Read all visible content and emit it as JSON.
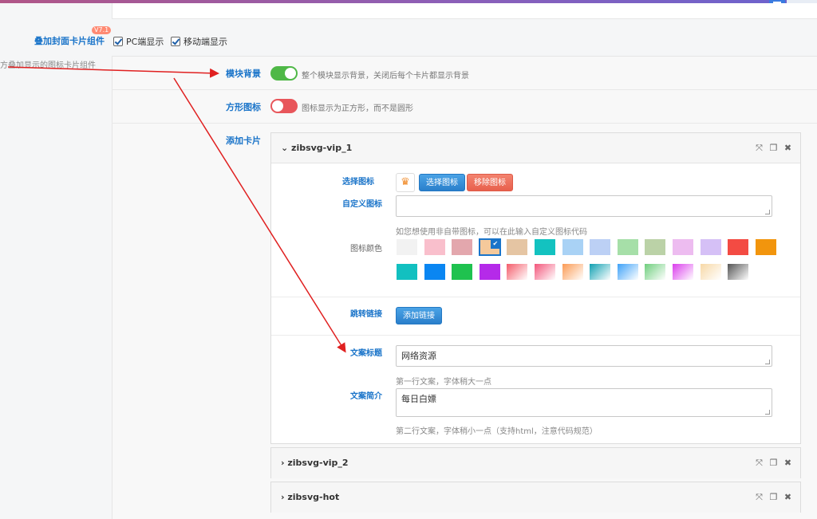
{
  "colors": {
    "accent": "#1a74c9",
    "toggle_on": "#4fb847",
    "toggle_off": "#e8565b",
    "annotation_arrow": "#e02020"
  },
  "section": {
    "label": "叠加封面卡片组件",
    "version_badge": "V7.1",
    "side_description": "方叠加显示的图标卡片组件",
    "checkboxes": [
      {
        "label": "PC端显示",
        "checked": true
      },
      {
        "label": "移动端显示",
        "checked": true
      }
    ]
  },
  "module_bg": {
    "label": "模块背景",
    "enabled": true,
    "description": "整个模块显示背景，关闭后每个卡片都显示背景"
  },
  "square_icon": {
    "label": "方形图标",
    "enabled": false,
    "description": "图标显示为正方形，而不是圆形"
  },
  "add_card": {
    "label": "添加卡片"
  },
  "cards": [
    {
      "title": "zibsvg-vip_1",
      "expanded": true,
      "icon_label": "选择图标",
      "icon_preview": "crown-icon",
      "select_icon_button": "选择图标",
      "remove_icon_button": "移除图标",
      "custom_icon_label": "自定义图标",
      "custom_icon_value": "",
      "custom_icon_hint": "如您想使用非自带图标，可以在此输入自定义图标代码",
      "icon_color_label": "图标颜色",
      "selected_swatch_index": 3,
      "swatches_row1": [
        "#f2f2f2",
        "#f9bfcc",
        "#e3a7ad",
        "#f5c99b",
        "#e5c5a3",
        "#13c2c0",
        "#a9d2f5",
        "#bcd0f5",
        "#a6dfa8",
        "#bbd2a7",
        "#edbcf0",
        "#d5c0f6",
        "#f34b43",
        "#f2950d"
      ],
      "swatches_row2": [
        "#12c0c0",
        "#0a86f2",
        "#1fc24f",
        "#b52ae9",
        "#f45c6a",
        "#f3557a",
        "#fb9a54",
        "#10a0b2",
        "#3ea2f8",
        "#6fce7d",
        "#da3dec",
        "#f7d8a6",
        "#555555"
      ],
      "link_label": "跳转链接",
      "add_link_button": "添加链接",
      "title_label": "文案标题",
      "title_value": "网络资源",
      "title_hint": "第一行文案，字体稍大一点",
      "subtitle_label": "文案简介",
      "subtitle_value": "每日白嫖",
      "subtitle_hint": "第二行文案，字体稍小一点（支持html，注意代码规范）"
    },
    {
      "title": "zibsvg-vip_2",
      "expanded": false
    },
    {
      "title": "zibsvg-hot",
      "expanded": false
    }
  ]
}
